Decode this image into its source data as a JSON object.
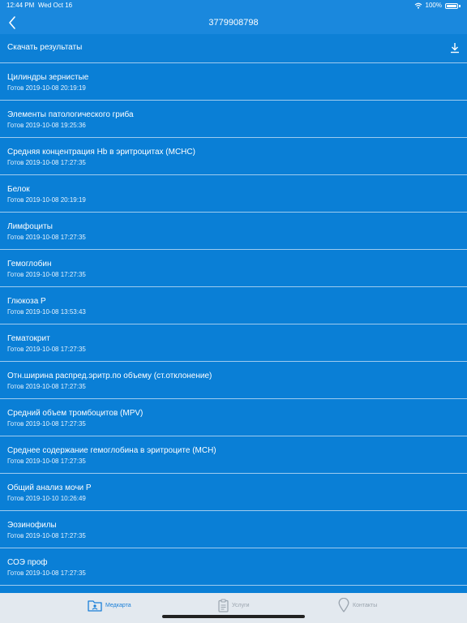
{
  "status": {
    "time": "12:44 PM",
    "date": "Wed Oct 16",
    "battery": "100%"
  },
  "header": {
    "title": "3779908798"
  },
  "download": {
    "label": "Скачать результаты"
  },
  "items": [
    {
      "title": "Цилиндры зернистые",
      "subtitle": "Готов 2019-10-08 20:19:19"
    },
    {
      "title": "Элементы патологического гриба",
      "subtitle": "Готов 2019-10-08 19:25:36"
    },
    {
      "title": "Средняя концентрация Hb в эритроцитах (MCHC)",
      "subtitle": "Готов 2019-10-08 17:27:35"
    },
    {
      "title": "Белок",
      "subtitle": "Готов 2019-10-08 20:19:19"
    },
    {
      "title": "Лимфоциты",
      "subtitle": "Готов 2019-10-08 17:27:35"
    },
    {
      "title": "Гемоглобин",
      "subtitle": "Готов 2019-10-08 17:27:35"
    },
    {
      "title": "Глюкоза Р",
      "subtitle": "Готов 2019-10-08 13:53:43"
    },
    {
      "title": "Гематокрит",
      "subtitle": "Готов 2019-10-08 17:27:35"
    },
    {
      "title": "Отн.ширина распред.эритр.по объему (ст.отклонение)",
      "subtitle": "Готов 2019-10-08 17:27:35"
    },
    {
      "title": "Средний объем тромбоцитов (MPV)",
      "subtitle": "Готов 2019-10-08 17:27:35"
    },
    {
      "title": "Среднее содержание гемоглобина в эритроците (MCH)",
      "subtitle": "Готов 2019-10-08 17:27:35"
    },
    {
      "title": "Общий анализ мочи Р",
      "subtitle": "Готов 2019-10-10 10:26:49"
    },
    {
      "title": "Эозинофилы",
      "subtitle": "Готов 2019-10-08 17:27:35"
    },
    {
      "title": "СОЭ проф",
      "subtitle": "Готов 2019-10-08 17:27:35"
    }
  ],
  "tabs": [
    {
      "label": "Медкарта",
      "icon": "medcard-icon",
      "active": true
    },
    {
      "label": "Услуги",
      "icon": "clipboard-icon",
      "active": false
    },
    {
      "label": "Контакты",
      "icon": "location-pin-icon",
      "active": false
    }
  ],
  "colors": {
    "background": "#0A7FD6",
    "header": "#1A88DD",
    "separator": "#9ECBEF",
    "tabbar": "#E3E9EF",
    "tab_active": "#1A7FD8",
    "tab_inactive": "#9AA4AE"
  }
}
